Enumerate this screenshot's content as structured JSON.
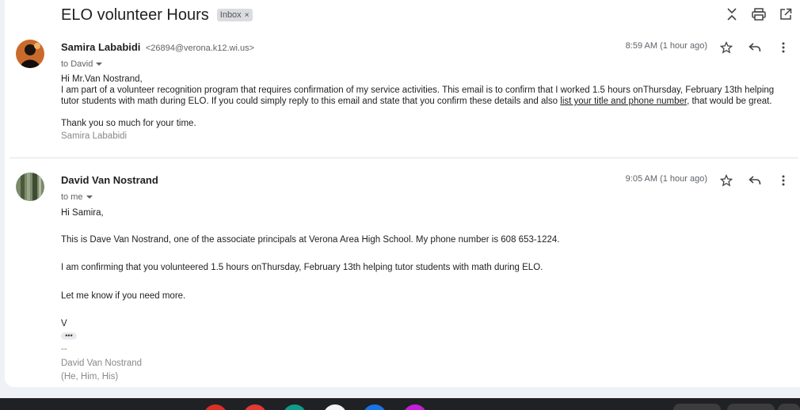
{
  "thread": {
    "subject": "ELO volunteer Hours",
    "label": "Inbox",
    "label_remove": "×"
  },
  "toolbar_icons": [
    "collapse-icon",
    "print-icon",
    "open-new-window-icon"
  ],
  "messages": [
    {
      "sender": "Samira Lababidi",
      "email": "<26894@verona.k12.wi.us>",
      "to": "to David",
      "time": "8:59 AM (1 hour ago)",
      "greeting": "Hi Mr.Van Nostrand,",
      "para1_a": "I am part of a volunteer recognition program that requires confirmation of my service activities. This email is to confirm that I worked 1.5 hours onThursday, February 13th helping tutor students with math during ELO. If you could simply reply to this email and state that you confirm these details and also ",
      "para1_link": "list your title and phone number",
      "para1_b": ", that would be great.",
      "thanks": "Thank you so much for your time.",
      "signature": "Samira Lababidi"
    },
    {
      "sender": "David Van Nostrand",
      "to": "to me",
      "time": "9:05 AM (1 hour ago)",
      "greeting": "Hi Samira,",
      "para1": "This is Dave Van Nostrand, one of the associate principals at Verona Area High School. My phone number is 608 653-1224.",
      "para2": "I am confirming that you volunteered 1.5 hours onThursday, February 13th helping tutor students with math during ELO.",
      "para3": "Let me know if you need more.",
      "initial": "V",
      "ellipsis": "•••",
      "sig_dash": "--",
      "sig_name": "David Van Nostrand",
      "sig_pronouns": "(He, Him, His)"
    }
  ],
  "colors": {
    "page_bg": "#eef2f6",
    "card_bg": "#ffffff",
    "muted_text": "#5f6368",
    "taskbar": "#202124"
  }
}
